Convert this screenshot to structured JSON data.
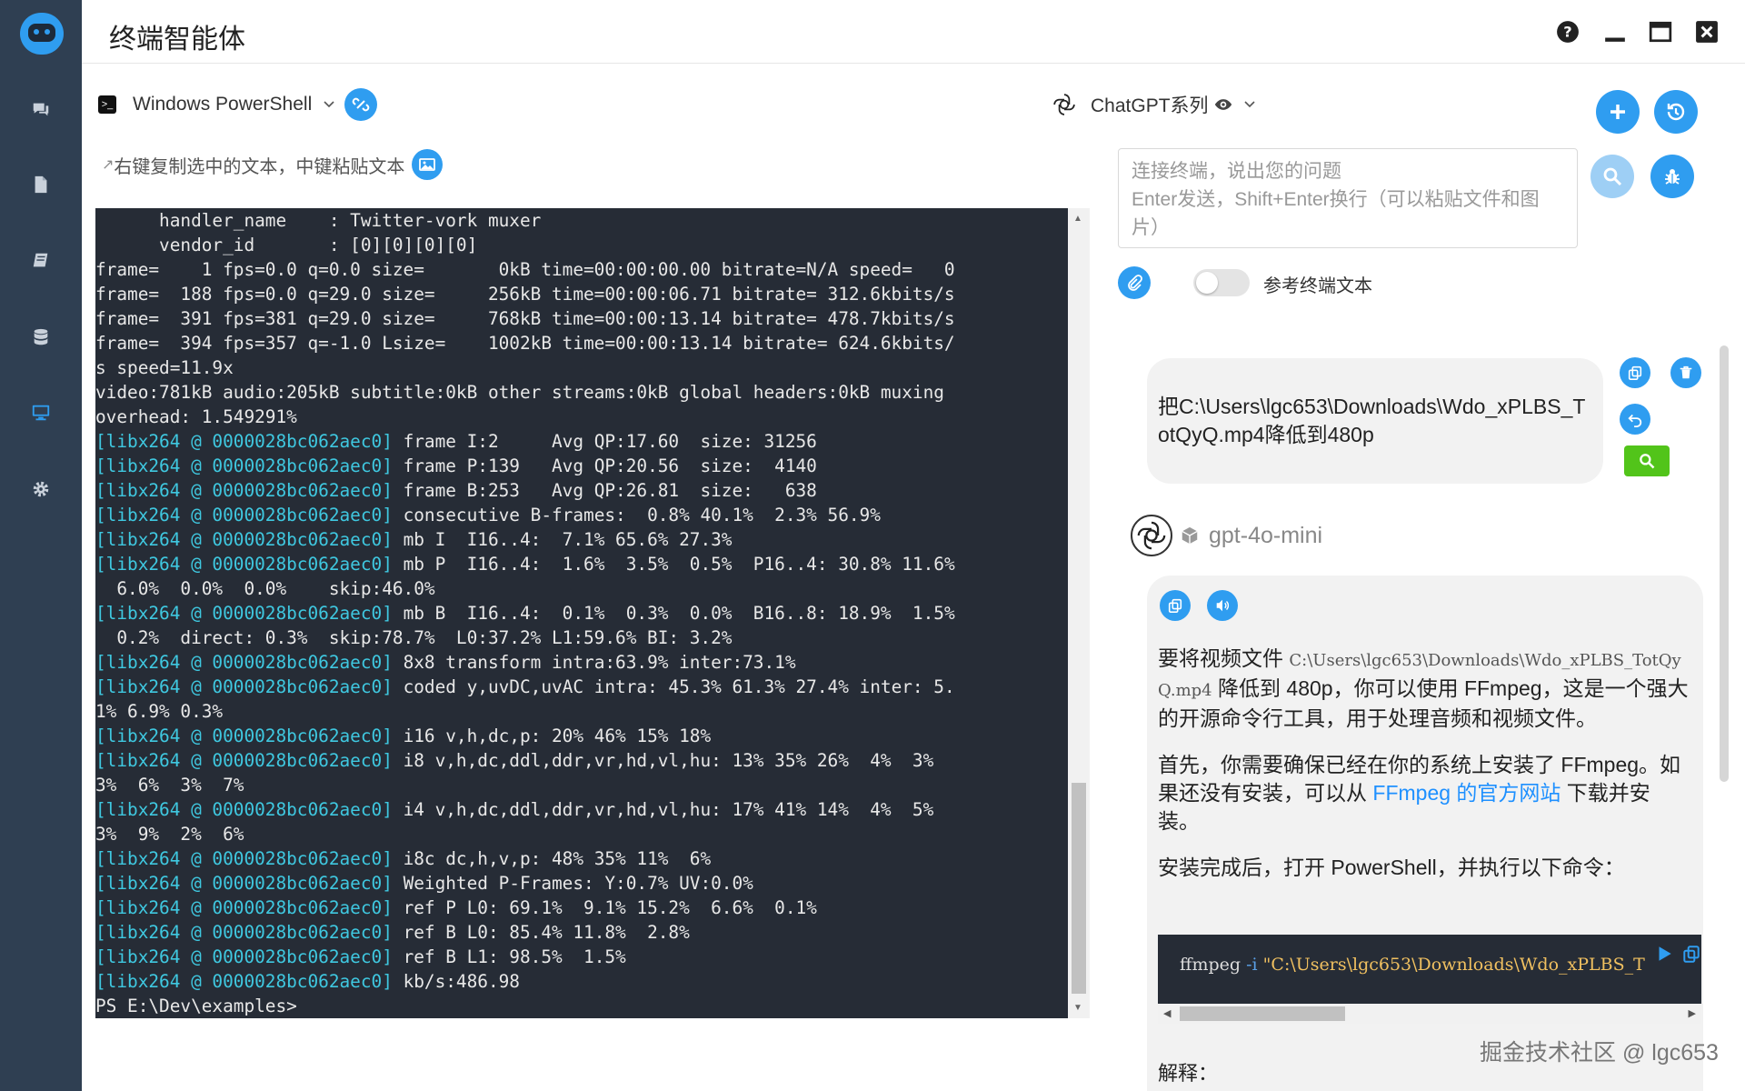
{
  "app": {
    "title": "终端智能体",
    "colors": {
      "accent": "#2f9df0",
      "sidebar": "#2f3f52",
      "terminal_bg": "#262c36",
      "terminal_cyan": "#3fc8e0",
      "green": "#52c41a"
    }
  },
  "sidebar": {
    "items": [
      {
        "icon": "chat-icon"
      },
      {
        "icon": "file-icon"
      },
      {
        "icon": "book-icon"
      },
      {
        "icon": "database-icon"
      },
      {
        "icon": "monitor-icon",
        "active": true
      },
      {
        "icon": "gear-icon"
      }
    ]
  },
  "terminal": {
    "shell_label": "Windows PowerShell",
    "hint": "右键复制选中的文本，中键粘贴文本",
    "lines": [
      {
        "t": "      handler_name    : Twitter-vork muxer"
      },
      {
        "t": "      vendor_id       : [0][0][0][0]"
      },
      {
        "t": "frame=    1 fps=0.0 q=0.0 size=       0kB time=00:00:00.00 bitrate=N/A speed=   0"
      },
      {
        "t": "frame=  188 fps=0.0 q=29.0 size=     256kB time=00:00:06.71 bitrate= 312.6kbits/s"
      },
      {
        "t": "frame=  391 fps=381 q=29.0 size=     768kB time=00:00:13.14 bitrate= 478.7kbits/s"
      },
      {
        "t": "frame=  394 fps=357 q=-1.0 Lsize=    1002kB time=00:00:13.14 bitrate= 624.6kbits/"
      },
      {
        "t": "s speed=11.9x"
      },
      {
        "t": "video:781kB audio:205kB subtitle:0kB other streams:0kB global headers:0kB muxing"
      },
      {
        "t": "overhead: 1.549291%"
      },
      {
        "p": "[libx264 @ 0000028bc062aec0]",
        "t": " frame I:2     Avg QP:17.60  size: 31256"
      },
      {
        "p": "[libx264 @ 0000028bc062aec0]",
        "t": " frame P:139   Avg QP:20.56  size:  4140"
      },
      {
        "p": "[libx264 @ 0000028bc062aec0]",
        "t": " frame B:253   Avg QP:26.81  size:   638"
      },
      {
        "p": "[libx264 @ 0000028bc062aec0]",
        "t": " consecutive B-frames:  0.8% 40.1%  2.3% 56.9%"
      },
      {
        "p": "[libx264 @ 0000028bc062aec0]",
        "t": " mb I  I16..4:  7.1% 65.6% 27.3%"
      },
      {
        "p": "[libx264 @ 0000028bc062aec0]",
        "t": " mb P  I16..4:  1.6%  3.5%  0.5%  P16..4: 30.8% 11.6%"
      },
      {
        "t": "  6.0%  0.0%  0.0%    skip:46.0%"
      },
      {
        "p": "[libx264 @ 0000028bc062aec0]",
        "t": " mb B  I16..4:  0.1%  0.3%  0.0%  B16..8: 18.9%  1.5%"
      },
      {
        "t": "  0.2%  direct: 0.3%  skip:78.7%  L0:37.2% L1:59.6% BI: 3.2%"
      },
      {
        "p": "[libx264 @ 0000028bc062aec0]",
        "t": " 8x8 transform intra:63.9% inter:73.1%"
      },
      {
        "p": "[libx264 @ 0000028bc062aec0]",
        "t": " coded y,uvDC,uvAC intra: 45.3% 61.3% 27.4% inter: 5."
      },
      {
        "t": "1% 6.9% 0.3%"
      },
      {
        "p": "[libx264 @ 0000028bc062aec0]",
        "t": " i16 v,h,dc,p: 20% 46% 15% 18%"
      },
      {
        "p": "[libx264 @ 0000028bc062aec0]",
        "t": " i8 v,h,dc,ddl,ddr,vr,hd,vl,hu: 13% 35% 26%  4%  3%"
      },
      {
        "t": "3%  6%  3%  7%"
      },
      {
        "p": "[libx264 @ 0000028bc062aec0]",
        "t": " i4 v,h,dc,ddl,ddr,vr,hd,vl,hu: 17% 41% 14%  4%  5%"
      },
      {
        "t": "3%  9%  2%  6%"
      },
      {
        "p": "[libx264 @ 0000028bc062aec0]",
        "t": " i8c dc,h,v,p: 48% 35% 11%  6%"
      },
      {
        "p": "[libx264 @ 0000028bc062aec0]",
        "t": " Weighted P-Frames: Y:0.7% UV:0.0%"
      },
      {
        "p": "[libx264 @ 0000028bc062aec0]",
        "t": " ref P L0: 69.1%  9.1% 15.2%  6.6%  0.1%"
      },
      {
        "p": "[libx264 @ 0000028bc062aec0]",
        "t": " ref B L0: 85.4% 11.8%  2.8%"
      },
      {
        "p": "[libx264 @ 0000028bc062aec0]",
        "t": " ref B L1: 98.5%  1.5%"
      },
      {
        "p": "[libx264 @ 0000028bc062aec0]",
        "t": " kb/s:486.98"
      },
      {
        "t": "PS E:\\Dev\\examples>"
      }
    ]
  },
  "assistant": {
    "model_series": "ChatGPT系列",
    "input_placeholder_1": "连接终端，说出您的问题",
    "input_placeholder_2": "Enter发送，Shift+Enter换行（可以粘贴文件和图片）",
    "toggle_label": "参考终端文本",
    "toggle_on": false,
    "user_message": "把C:\\Users\\lgc653\\Downloads\\Wdo_xPLBS_TotQyQ.mp4降低到480p",
    "bot_name": "gpt-4o-mini",
    "bot_p1_a": "要将视频文件 ",
    "bot_p1_code": "C:\\Users\\lgc653\\Downloads\\Wdo_xPLBS_TotQyQ.mp4",
    "bot_p1_b": " 降低到 480p，你可以使用 FFmpeg，这是一个强大的开源命令行工具，用于处理音频和视频文件。",
    "bot_p2_a": "首先，你需要确保已经在你的系统上安装了 FFmpeg。如果还没有安装，可以从 ",
    "bot_p2_link": "FFmpeg 的官方网站",
    "bot_p2_b": " 下载并安装。",
    "bot_p3": "安装完成后，打开 PowerShell，并执行以下命令：",
    "code_cmd": "ffmpeg",
    "code_flag": " -i",
    "code_str": " \"C:\\Users\\lgc653\\Downloads\\Wdo_xPLBS_T",
    "cut_text": "解释："
  },
  "watermark": "掘金技术社区 @ lgc653"
}
